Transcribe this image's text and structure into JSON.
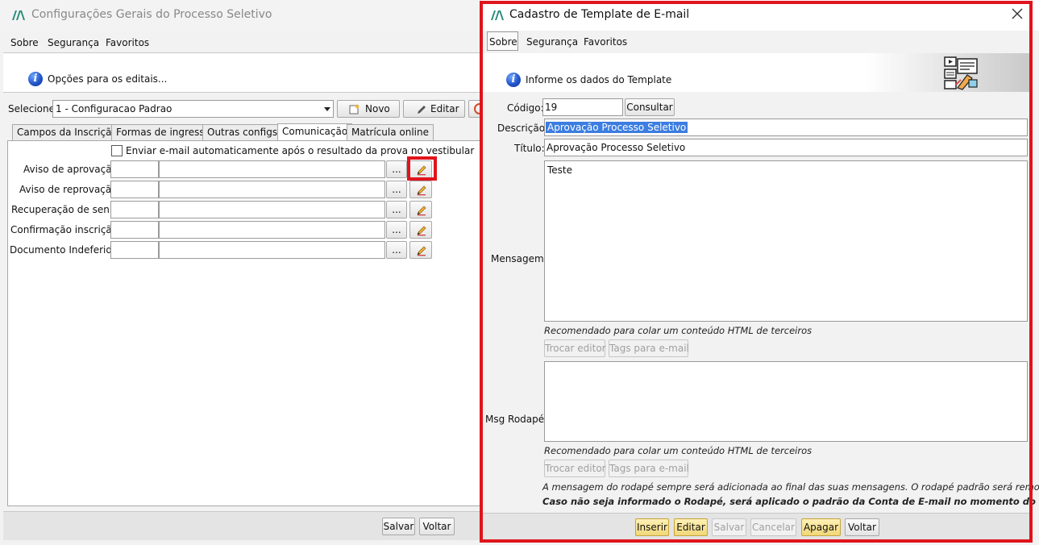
{
  "bg_window": {
    "title": "Configurações Gerais do Processo Seletivo",
    "menu": [
      "Sobre",
      "Segurança",
      "Favoritos"
    ],
    "info_text": "Opções para os editais...",
    "select_label": "Selecione:",
    "select_value": "1 - Configuracao Padrao",
    "new_label": "Novo",
    "edit_label": "Editar",
    "tabs": [
      "Campos da Inscrição",
      "Formas de ingresso",
      "Outras configs.",
      "Comunicação",
      "Matrícula online"
    ],
    "active_tab": "Comunicação",
    "checkbox_label": "Enviar e-mail automaticamente após o resultado da prova no vestibular",
    "rows": [
      {
        "label": "Aviso de aprovação:"
      },
      {
        "label": "Aviso de reprovação:"
      },
      {
        "label": "Recuperação de senha:"
      },
      {
        "label": "Confirmação inscrição:"
      },
      {
        "label": "Documento Indeferido:"
      }
    ],
    "ellipsis": "...",
    "save_label": "Salvar",
    "back_label": "Voltar"
  },
  "dialog": {
    "title": "Cadastro de Template de E-mail",
    "menu": [
      "Sobre",
      "Segurança",
      "Favoritos"
    ],
    "info_text": "Informe os dados do Template",
    "codigo_label": "Código:",
    "codigo_value": "19",
    "consultar_label": "Consultar",
    "descricao_label": "Descrição:",
    "descricao_value": "Aprovação Processo Seletivo",
    "titulo_label": "Título:",
    "titulo_value": "Aprovação Processo Seletivo",
    "mensagem_label": "Mensagem:",
    "mensagem_value": "Teste",
    "html_note_1": "Recomendado para colar um conteúdo HTML de terceiros",
    "trocar_editor_1": "Trocar editor",
    "tags_email_1": "Tags para e-mail",
    "rodape_label": "Msg Rodapé:",
    "html_note_2": "Recomendado para colar um conteúdo HTML de terceiros",
    "trocar_editor_2": "Trocar editor",
    "tags_email_2": "Tags para e-mail",
    "footer_note": "A mensagem do rodapé sempre será adicionada ao final das suas mensagens. O rodapé padrão será removido.",
    "footer_note_bold": "Caso não seja informado o Rodapé, será aplicado o padrão da Conta de E-mail no momento do envio.",
    "buttons": {
      "inserir": "Inserir",
      "editar": "Editar",
      "salvar": "Salvar",
      "cancelar": "Cancelar",
      "apagar": "Apagar",
      "voltar": "Voltar"
    }
  },
  "colors": {
    "highlight_red": "#e0141c",
    "selection_blue": "#3b7de0",
    "gold_button": "#f0d778"
  }
}
